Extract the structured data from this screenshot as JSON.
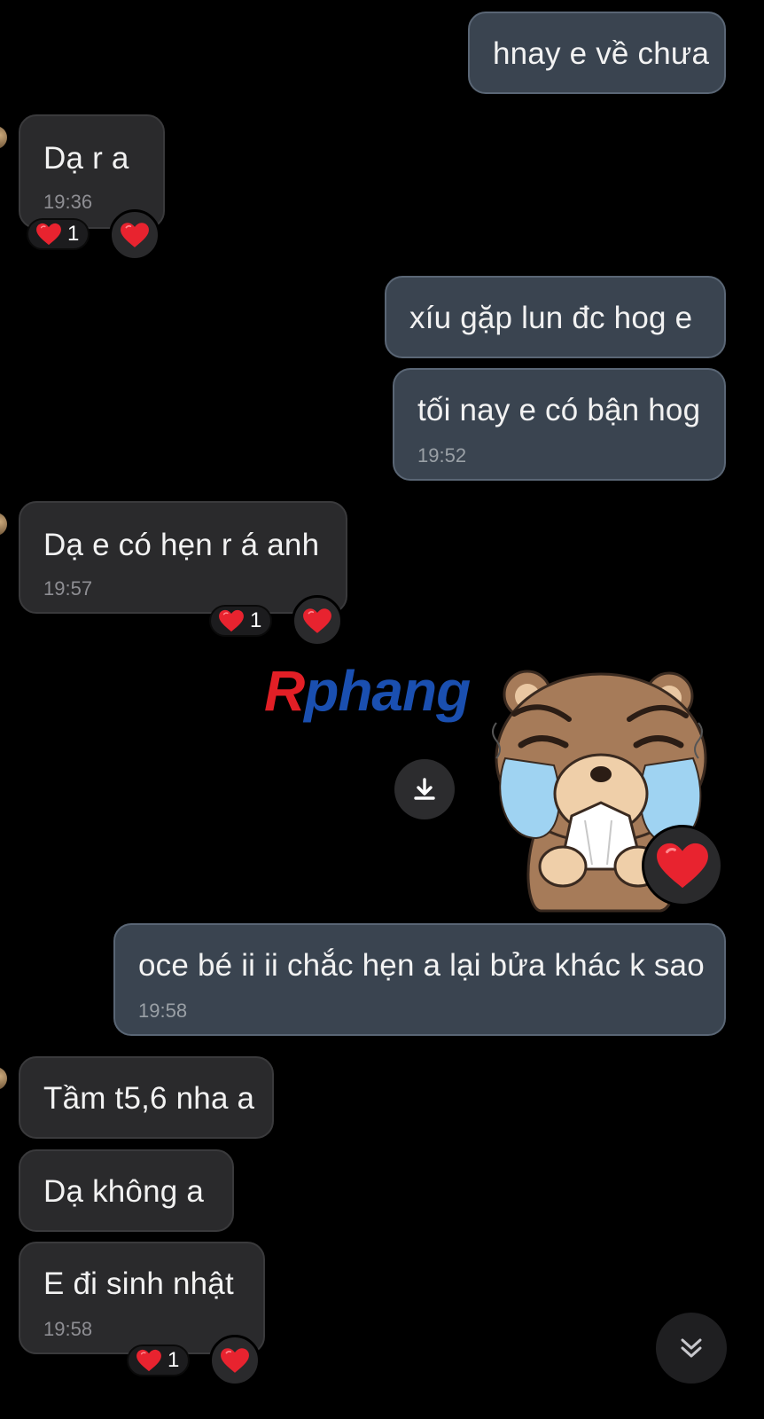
{
  "messages": [
    {
      "text": "hnay e về chưa"
    },
    {
      "text": "Dạ r a",
      "time": "19:36",
      "reaction_count": "1"
    },
    {
      "text": "xíu gặp lun đc hog e"
    },
    {
      "text": "tối nay e có bận hog",
      "time": "19:52"
    },
    {
      "text": "Dạ e có hẹn r á anh",
      "time": "19:57",
      "reaction_count": "1"
    },
    {
      "text": "oce bé ii ii chắc hẹn a lại bửa khác k sao",
      "time": "19:58"
    },
    {
      "text": "Tầm t5,6 nha a"
    },
    {
      "text": "Dạ không a"
    },
    {
      "text": "E đi sinh nhật",
      "time": "19:58",
      "reaction_count": "1"
    }
  ],
  "sticker": {
    "icon": "crying-bear-sticker"
  },
  "watermark": {
    "part1": "R",
    "part2": "phang"
  },
  "icons": {
    "heart": "heart-icon",
    "download": "download-icon",
    "scroll": "chevron-double-down-icon"
  },
  "colors": {
    "background": "#000000",
    "sent_bubble": "#3a4450",
    "received_bubble": "#2a2a2c",
    "heart": "#e8232f"
  }
}
